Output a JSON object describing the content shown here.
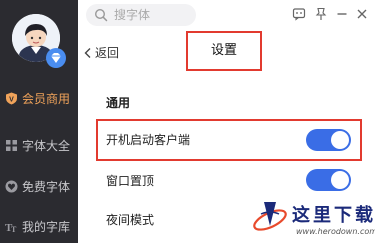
{
  "sidebar": {
    "items": [
      {
        "label": "会员商用",
        "icon": "vip-shield-icon",
        "active": true
      },
      {
        "label": "字体大全",
        "icon": "grid-icon",
        "active": false
      },
      {
        "label": "免费字体",
        "icon": "heart-icon",
        "active": false
      },
      {
        "label": "我的字库",
        "icon": "font-tt-icon",
        "active": false
      }
    ]
  },
  "search": {
    "placeholder": "搜字体"
  },
  "window": {
    "icons": [
      "message-icon",
      "pin-icon",
      "minimize-icon",
      "close-icon"
    ]
  },
  "header": {
    "back_label": "返回",
    "title": "设置"
  },
  "settings": {
    "section_title": "通用",
    "rows": [
      {
        "label": "开机启动客户端",
        "toggle": true
      },
      {
        "label": "窗口置顶",
        "toggle": true
      },
      {
        "label": "夜间模式",
        "toggle": false
      }
    ]
  },
  "colors": {
    "accent": "#3a6de6",
    "active_nav": "#f0a35a",
    "highlight": "#e23a2f",
    "sidebar_bg": "#2b2b30"
  },
  "watermark": {
    "text": "这里下载",
    "url": "www.herodown.com"
  }
}
